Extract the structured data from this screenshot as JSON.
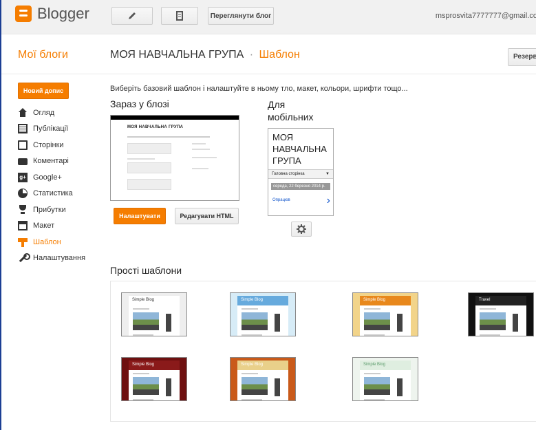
{
  "topbar": {
    "logo_text": "Blogger",
    "view_blog_label": "Переглянути блог",
    "user_email": "msprosvita7777777@gmail.co"
  },
  "header": {
    "my_blogs": "Мої блоги",
    "blog_name": "МОЯ НАВЧАЛЬНА ГРУПА",
    "separator": "·",
    "section": "Шаблон",
    "backup_label": "Резервн"
  },
  "sidebar": {
    "new_post_label": "Новий допис",
    "items": [
      {
        "label": "Огляд",
        "icon": "home-icon"
      },
      {
        "label": "Публікації",
        "icon": "posts-icon"
      },
      {
        "label": "Сторінки",
        "icon": "pages-icon"
      },
      {
        "label": "Коментарі",
        "icon": "comments-icon"
      },
      {
        "label": "Google+",
        "icon": "gplus-icon"
      },
      {
        "label": "Статистика",
        "icon": "stats-icon"
      },
      {
        "label": "Прибутки",
        "icon": "earnings-icon"
      },
      {
        "label": "Макет",
        "icon": "layout-icon"
      },
      {
        "label": "Шаблон",
        "icon": "template-icon"
      },
      {
        "label": "Налаштування",
        "icon": "settings-icon"
      }
    ],
    "active_index": 8
  },
  "main": {
    "intro": "Виберіть базовий шаблон і налаштуйте в ньому тло, макет, кольори, шрифти тощо...",
    "current_heading": "Зараз у блозі",
    "mobile_heading": "Для мобільних",
    "current_preview_title": "МОЯ НАВЧАЛЬНА ГРУПА",
    "mobile_preview": {
      "title": "МОЯ НАВЧАЛЬНА ГРУПА",
      "home_label": "Головна сторінка",
      "dropdown_glyph": "▼",
      "date_text": "середа, 22 березня 2014 р.",
      "link_text": "Опрацюв"
    },
    "customize_label": "Налаштувати",
    "edit_html_label": "Редагувати HTML",
    "simple_heading": "Прості шаблони",
    "templates": [
      {
        "title": "Simple Blog",
        "head_bg": "#ffffff",
        "page_bg": "#eeeeee",
        "text": "#333333"
      },
      {
        "title": "Simple Blog",
        "head_bg": "#66aadd",
        "page_bg": "#d7ecf7",
        "text": "#ffffff"
      },
      {
        "title": "Simple Blog",
        "head_bg": "#e8881c",
        "page_bg": "#f2d48a",
        "text": "#ffffff"
      },
      {
        "title": "Travel",
        "head_bg": "#222222",
        "page_bg": "#111111",
        "text": "#ffffff"
      },
      {
        "title": "Simple Blog",
        "head_bg": "#8a1a1a",
        "page_bg": "#6e1010",
        "text": "#ffffff"
      },
      {
        "title": "Simple Blog",
        "head_bg": "#e9d08a",
        "page_bg": "#c95a1a",
        "text": "#ffffff"
      },
      {
        "title": "Simple Blog",
        "head_bg": "#dfeee0",
        "page_bg": "#eef4ee",
        "text": "#5a9a6a"
      }
    ]
  },
  "colors": {
    "accent": "#f57d00",
    "frame_border": "#1c3f94"
  }
}
